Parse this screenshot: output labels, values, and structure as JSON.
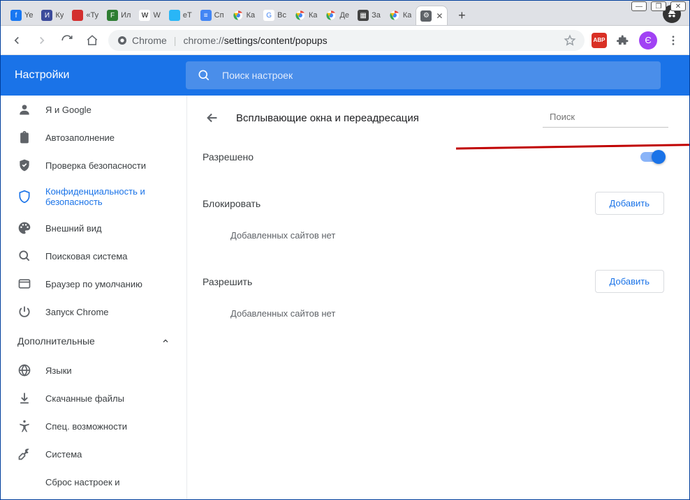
{
  "window_buttons": {
    "min": "—",
    "max": "❐",
    "close": "✕"
  },
  "tabs": [
    {
      "label": "Ye",
      "favicon_bg": "#1877f2",
      "favicon_text": "f"
    },
    {
      "label": "Ку",
      "favicon_bg": "#3b4a9b",
      "favicon_text": "И"
    },
    {
      "label": "«Ту",
      "favicon_bg": "#d32f2f",
      "favicon_text": ""
    },
    {
      "label": "Ил",
      "favicon_bg": "#2e7d32",
      "favicon_text": "F"
    },
    {
      "label": "W",
      "favicon_bg": "#ffffff",
      "favicon_text": "W",
      "favicon_fg": "#000"
    },
    {
      "label": "eT",
      "favicon_bg": "#29b6f6",
      "favicon_text": ""
    },
    {
      "label": "Сп",
      "favicon_bg": "#4285f4",
      "favicon_text": "≡"
    },
    {
      "label": "Ка",
      "favicon_bg": "#ffffff",
      "favicon_text": "",
      "chrome": true
    },
    {
      "label": "Вс",
      "favicon_bg": "#ffffff",
      "favicon_text": "G",
      "favicon_fg": "#4285f4"
    },
    {
      "label": "Ка",
      "favicon_bg": "#ffffff",
      "favicon_text": "",
      "chrome": true
    },
    {
      "label": "Де",
      "favicon_bg": "#ffffff",
      "favicon_text": "",
      "chrome": true
    },
    {
      "label": "За",
      "favicon_bg": "#424242",
      "favicon_text": "▦"
    },
    {
      "label": "Ка",
      "favicon_bg": "#ffffff",
      "favicon_text": "",
      "chrome": true
    },
    {
      "label": "",
      "favicon_bg": "#5f6368",
      "favicon_text": "⚙",
      "active": true,
      "closable": true
    }
  ],
  "newtab": "+",
  "toolbar": {
    "secure_label": "Chrome",
    "url_prefix": "chrome://",
    "url_path": "settings/content/popups",
    "ext_badge": "ABP",
    "avatar_letter": "Є"
  },
  "bluebar": {
    "title": "Настройки",
    "search_placeholder": "Поиск настроек"
  },
  "sidebar": {
    "items": [
      {
        "icon": "person",
        "label": "Я и Google"
      },
      {
        "icon": "clipboard",
        "label": "Автозаполнение"
      },
      {
        "icon": "shield-check",
        "label": "Проверка безопасности"
      },
      {
        "icon": "shield",
        "label": "Конфиденциальность и безопасность",
        "active": true
      },
      {
        "icon": "palette",
        "label": "Внешний вид"
      },
      {
        "icon": "search",
        "label": "Поисковая система"
      },
      {
        "icon": "browser",
        "label": "Браузер по умолчанию"
      },
      {
        "icon": "power",
        "label": "Запуск Chrome"
      }
    ],
    "section": "Дополнительные",
    "items2": [
      {
        "icon": "globe",
        "label": "Языки"
      },
      {
        "icon": "download",
        "label": "Скачанные файлы"
      },
      {
        "icon": "accessibility",
        "label": "Спец. возможности"
      },
      {
        "icon": "wrench",
        "label": "Система"
      },
      {
        "icon": "",
        "label": "Сброс настроек и"
      }
    ]
  },
  "panel": {
    "title": "Всплывающие окна и переадресация",
    "search_placeholder": "Поиск",
    "allowed_label": "Разрешено",
    "block_label": "Блокировать",
    "allow_label": "Разрешить",
    "add_button": "Добавить",
    "empty_text": "Добавленных сайтов нет"
  }
}
